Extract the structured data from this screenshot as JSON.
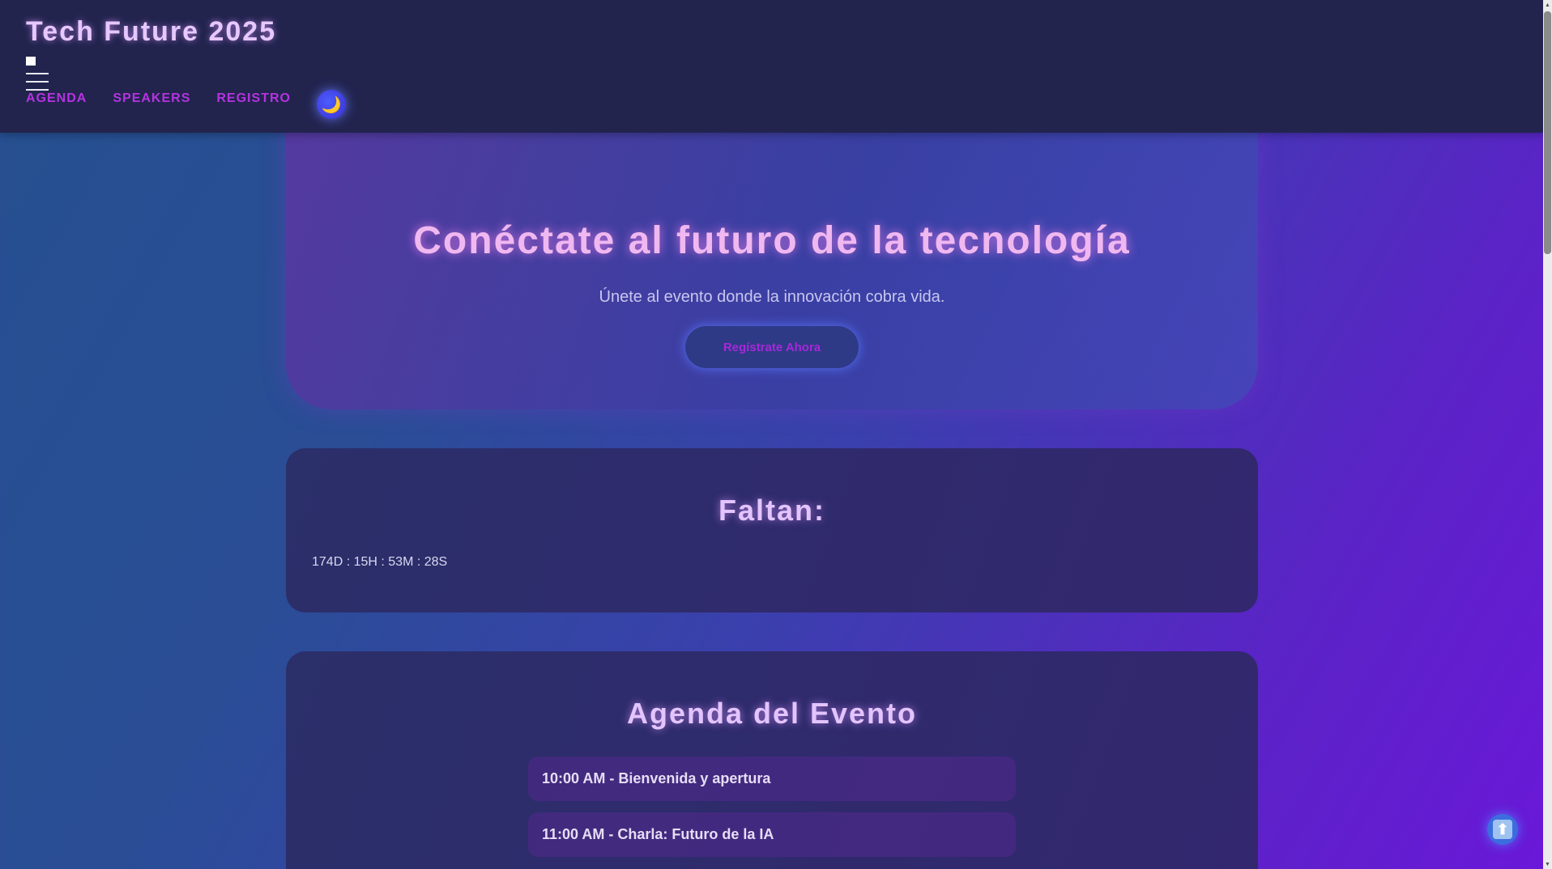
{
  "header": {
    "brand": "Tech Future 2025",
    "nav": [
      {
        "label": "AGENDA"
      },
      {
        "label": "SPEAKERS"
      },
      {
        "label": "REGISTRO"
      }
    ],
    "theme_toggle_icon": "moon-icon",
    "theme_toggle_glyph": "🌙",
    "nav_color": "#b533e0"
  },
  "hero": {
    "title": "Conéctate al futuro de la tecnología",
    "subtitle": "Únete al evento donde la innovación cobra vida.",
    "cta_label": "Regístrate Ahora"
  },
  "countdown": {
    "title": "Faltan:",
    "value": "174D : 15H : 53M : 28S"
  },
  "agenda": {
    "title": "Agenda del Evento",
    "items": [
      {
        "text": "10:00 AM - Bienvenida y apertura"
      },
      {
        "text": "11:00 AM - Charla: Futuro de la IA"
      }
    ]
  },
  "scroll_top": {
    "icon": "arrow-up-icon",
    "glyph": "⬆"
  },
  "colors": {
    "accent": "#b533e0",
    "title_glow": "#f0b8f0",
    "header_bg": "#22244e"
  }
}
